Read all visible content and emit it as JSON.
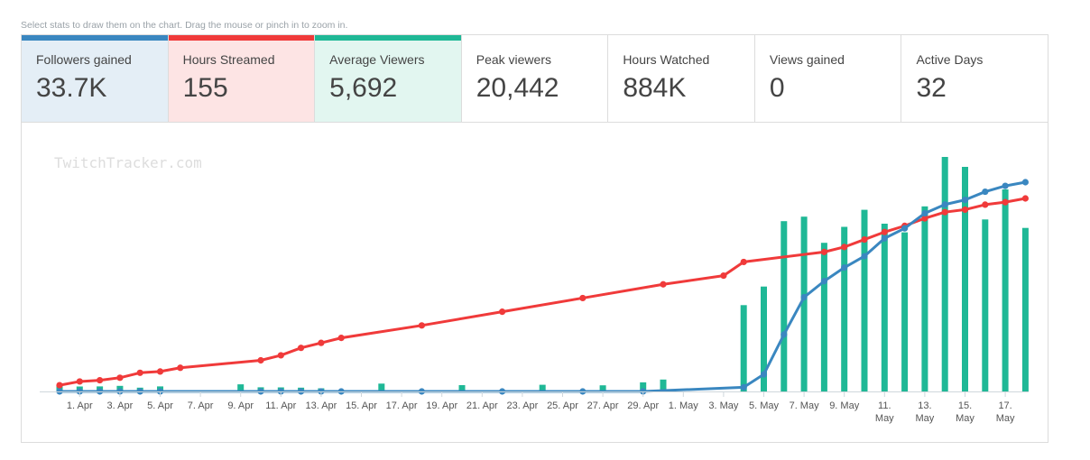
{
  "hint": "Select stats to draw them on the chart. Drag the mouse or pinch in to zoom in.",
  "watermark": "TwitchTracker.com",
  "stats": [
    {
      "label": "Followers gained",
      "value": "33.7K",
      "active": true,
      "color": "#3a87c0",
      "bg": "#e4eef6"
    },
    {
      "label": "Hours Streamed",
      "value": "155",
      "active": true,
      "color": "#f03a3a",
      "bg": "#fde4e4"
    },
    {
      "label": "Average Viewers",
      "value": "5,692",
      "active": true,
      "color": "#1fb896",
      "bg": "#e2f6f0"
    },
    {
      "label": "Peak viewers",
      "value": "20,442",
      "active": false
    },
    {
      "label": "Hours Watched",
      "value": "884K",
      "active": false
    },
    {
      "label": "Views gained",
      "value": "0",
      "active": false
    },
    {
      "label": "Active Days",
      "value": "32",
      "active": false
    }
  ],
  "chart_data": {
    "type": "bar+line",
    "x_start": "31 Mar",
    "x_end": "17 May",
    "x_tick_labels": [
      "1. Apr",
      "3. Apr",
      "5. Apr",
      "7. Apr",
      "9. Apr",
      "11. Apr",
      "13. Apr",
      "15. Apr",
      "17. Apr",
      "19. Apr",
      "21. Apr",
      "23. Apr",
      "25. Apr",
      "27. Apr",
      "29. Apr",
      "1. May",
      "3. May",
      "5. May",
      "7. May",
      "9. May",
      "11. May",
      "13. May",
      "15. May",
      "17. May"
    ],
    "y_axis": "hidden",
    "grid": false,
    "colors": {
      "followers": "#3a87c0",
      "hours": "#f03a3a",
      "viewers": "#1fb896"
    },
    "bars": {
      "label": "Average Viewers",
      "x": [
        "31 Mar",
        "1 Apr",
        "2 Apr",
        "3 Apr",
        "4 Apr",
        "5 Apr",
        "9 Apr",
        "10 Apr",
        "11 Apr",
        "12 Apr",
        "13 Apr",
        "16 Apr",
        "20 Apr",
        "24 Apr",
        "27 Apr",
        "29 Apr",
        "30 Apr",
        "4 May",
        "5 May",
        "6 May",
        "7 May",
        "8 May",
        "9 May",
        "10 May",
        "11 May",
        "12 May",
        "13 May",
        "14 May",
        "15 May",
        "16 May",
        "17 May",
        "18 May"
      ],
      "values": [
        680,
        550,
        560,
        620,
        420,
        560,
        790,
        460,
        450,
        420,
        350,
        870,
        700,
        740,
        680,
        1010,
        1320,
        9570,
        11630,
        18880,
        19380,
        16480,
        18250,
        20140,
        18600,
        17640,
        20520,
        26000,
        24900,
        19070,
        22400,
        18130
      ]
    },
    "followers_line": {
      "label": "Followers gained",
      "x": [
        "31 Mar",
        "1 Apr",
        "2 Apr",
        "3 Apr",
        "4 Apr",
        "5 Apr",
        "10 Apr",
        "11 Apr",
        "12 Apr",
        "13 Apr",
        "14 Apr",
        "18 Apr",
        "22 Apr",
        "26 Apr",
        "29 Apr",
        "4 May",
        "5 May",
        "6 May",
        "7 May",
        "8 May",
        "9 May",
        "10 May",
        "11 May",
        "12 May",
        "13 May",
        "14 May",
        "15 May",
        "16 May",
        "17 May",
        "18 May"
      ],
      "values": [
        0,
        0,
        0,
        0,
        0,
        0,
        0,
        0,
        0,
        0,
        0,
        0,
        0,
        0,
        0,
        430,
        1760,
        5860,
        9700,
        11350,
        12750,
        13920,
        15760,
        16790,
        18340,
        19240,
        19720,
        20560,
        21160,
        21540
      ]
    },
    "hours_line": {
      "label": "Hours Streamed",
      "x": [
        "31 Mar",
        "1 Apr",
        "2 Apr",
        "3 Apr",
        "4 Apr",
        "5 Apr",
        "6 Apr",
        "10 Apr",
        "11 Apr",
        "12 Apr",
        "13 Apr",
        "14 Apr",
        "18 Apr",
        "22 Apr",
        "26 Apr",
        "30 Apr",
        "3 May",
        "4 May",
        "8 May",
        "9 May",
        "10 May",
        "11 May",
        "12 May",
        "13 May",
        "14 May",
        "15 May",
        "16 May",
        "17 May",
        "18 May"
      ],
      "values": [
        5,
        8,
        9,
        11,
        15,
        16,
        19,
        25,
        29,
        35,
        39,
        43,
        53,
        64,
        75,
        86,
        93,
        104,
        112,
        116,
        122,
        128,
        133,
        139,
        144,
        146,
        150,
        152,
        155
      ]
    }
  }
}
